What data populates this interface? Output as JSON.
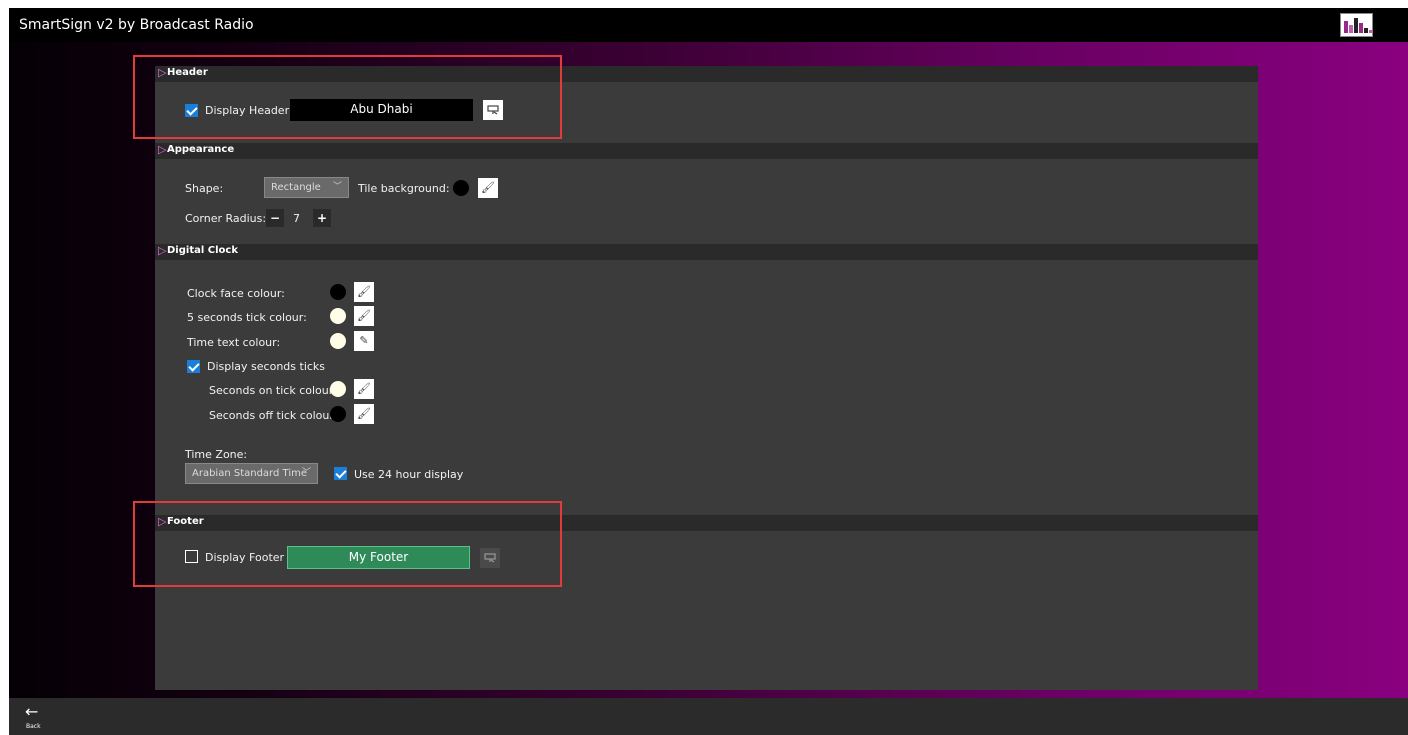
{
  "window": {
    "title": "SmartSign v2 by Broadcast Radio"
  },
  "sections": {
    "header": {
      "title": "Header",
      "display_label": "Display Header",
      "display_checked": true,
      "text_value": "Abu Dhabi"
    },
    "appearance": {
      "title": "Appearance",
      "shape_label": "Shape:",
      "shape_value": "Rectangle",
      "tile_background_label": "Tile background:",
      "corner_radius_label": "Corner Radius:",
      "minus_label": "−",
      "corner_radius_value": "7",
      "plus_label": "+"
    },
    "digital_clock": {
      "title": "Digital Clock",
      "clock_face_label": "Clock face colour:",
      "tick_label": "5 seconds tick colour:",
      "time_text_label": "Time text colour:",
      "display_seconds_label": "Display seconds ticks",
      "seconds_on_label": "Seconds on tick colour:",
      "seconds_off_label": "Seconds off tick colour:",
      "time_zone_label": "Time Zone:",
      "time_zone_value": "Arabian Standard Time",
      "use24_label": "Use 24 hour display"
    },
    "footer": {
      "title": "Footer",
      "display_label": "Display Footer",
      "display_checked": false,
      "text_value": "My Footer"
    }
  },
  "nav": {
    "back_label": "Back"
  },
  "colors": {
    "checkbox_accent": "#1a7fd8",
    "footer_fill": "#2e8b57",
    "header_fill": "#000000",
    "highlight_box": "#e03c3c",
    "section_triangle": "#e070e0"
  },
  "icons": {
    "header_edit": "monitor-icon",
    "picker": "eyedropper-icon",
    "pencil": "pencil-icon",
    "back": "arrow-left-icon"
  }
}
